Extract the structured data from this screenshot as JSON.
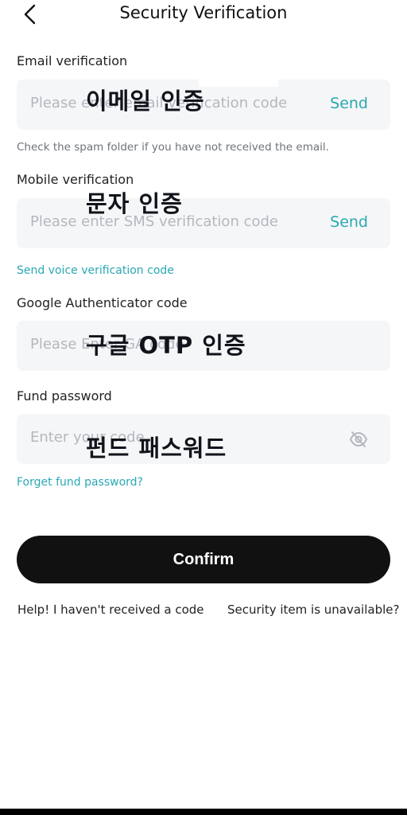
{
  "header": {
    "title": "Security Verification",
    "back_icon": "chevron-left-icon"
  },
  "email": {
    "label": "Email verification",
    "placeholder": "Please enter email verification code",
    "send": "Send",
    "hint": "Check the spam folder if you have not received the email.",
    "overlay": "이메일 인증"
  },
  "mobile": {
    "label": "Mobile verification",
    "placeholder": "Please enter SMS verification code",
    "send": "Send",
    "voice_link": "Send voice verification code",
    "overlay": "문자 인증"
  },
  "google": {
    "label": "Google Authenticator code",
    "placeholder": "Please Enter GA code",
    "overlay": "구글 OTP 인증"
  },
  "fund": {
    "label": "Fund password",
    "placeholder": "Enter your code",
    "eye_icon": "eye-off-icon",
    "forget_link": "Forget fund password?",
    "overlay": "펀드 패스워드"
  },
  "confirm_label": "Confirm",
  "footer": {
    "help": "Help! I haven't received a code",
    "unavailable": "Security item is unavailable?"
  },
  "colors": {
    "accent": "#2aa8b4",
    "button": "#111111",
    "field_bg": "#f5f6f7"
  }
}
